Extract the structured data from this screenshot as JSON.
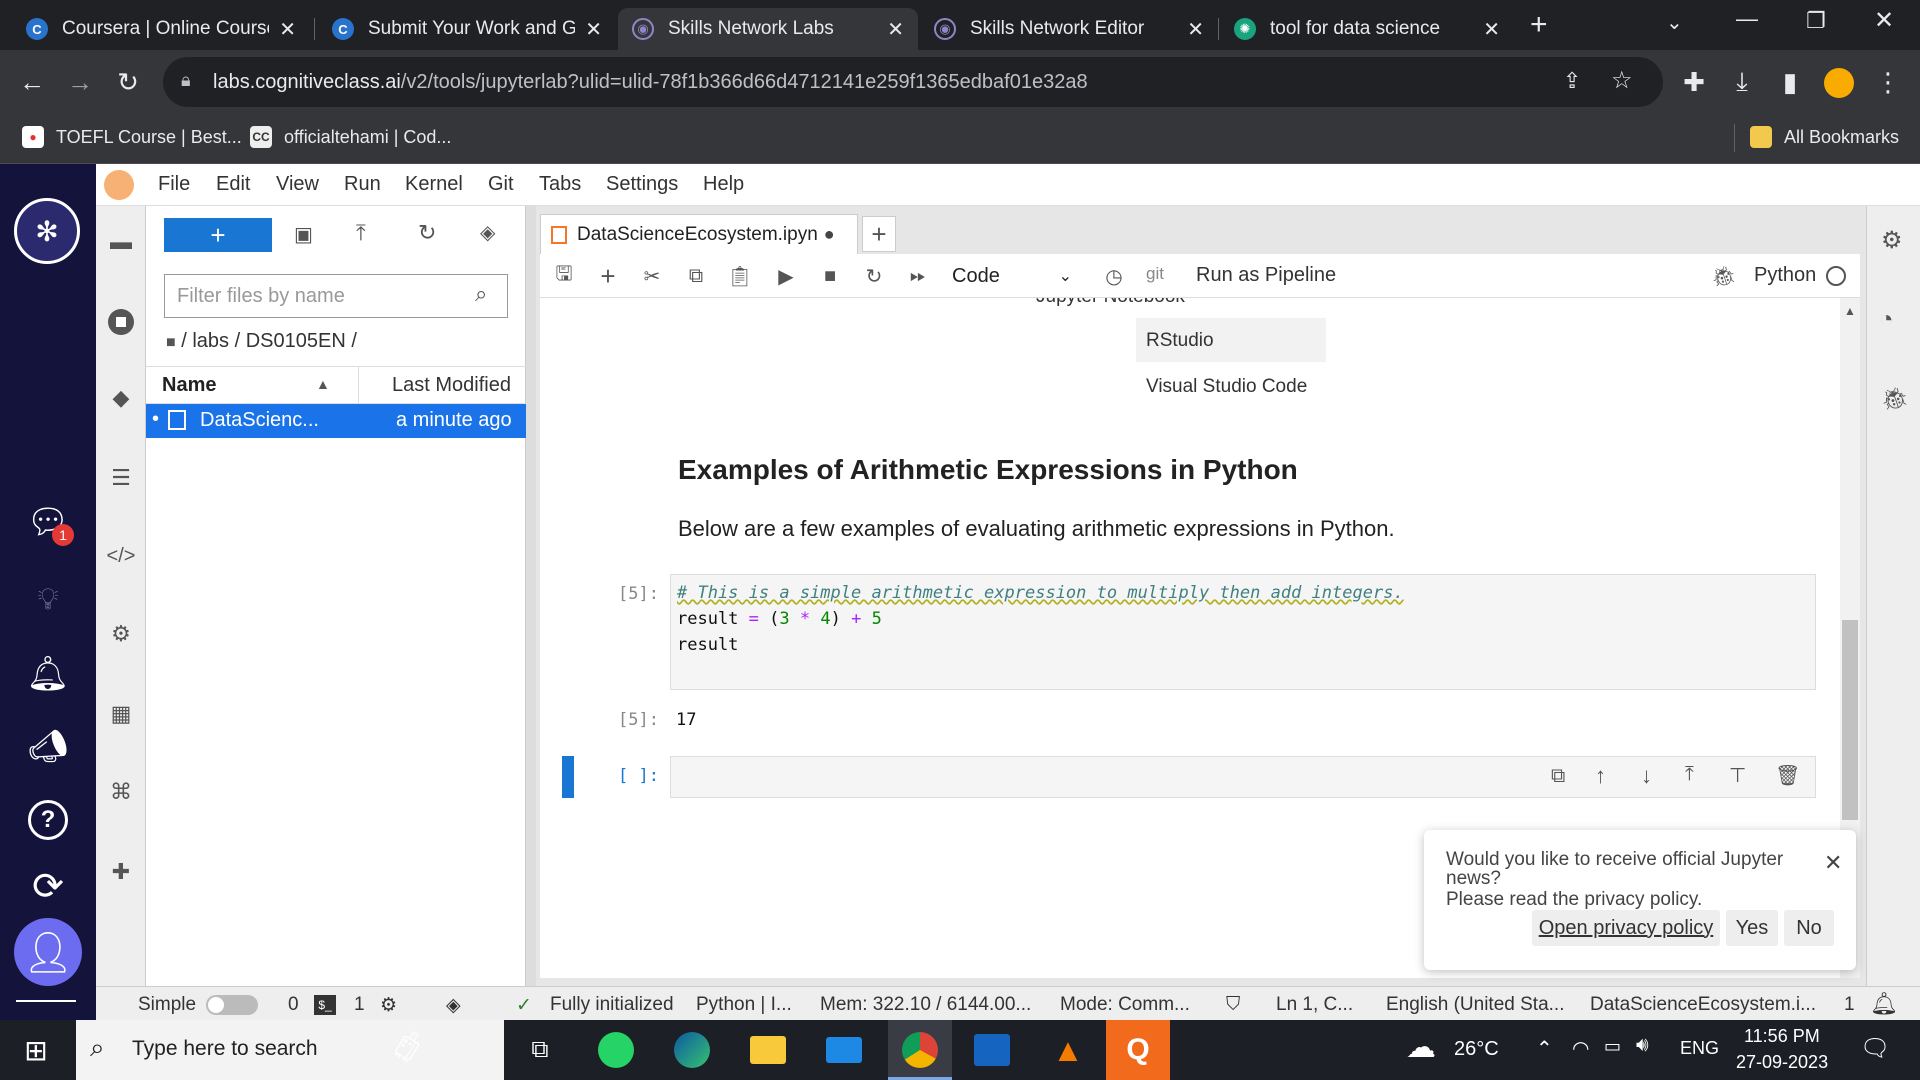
{
  "browser": {
    "tabs": [
      {
        "title": "Coursera | Online Course",
        "icon": "coursera-icon",
        "active": false
      },
      {
        "title": "Submit Your Work and Gr",
        "icon": "coursera-icon",
        "active": false
      },
      {
        "title": "Skills Network Labs",
        "icon": "skills-network-icon",
        "active": true
      },
      {
        "title": "Skills Network Editor",
        "icon": "skills-network-icon",
        "active": false
      },
      {
        "title": "tool for data science",
        "icon": "chatgpt-icon",
        "active": false
      }
    ],
    "url_host": "labs.cognitiveclass.ai",
    "url_path": "/v2/tools/jupyterlab?ulid=ulid-78f1b366d66d4712141e259f1365edbaf01e32a8",
    "bookmarks": [
      {
        "label": "TOEFL Course | Best..."
      },
      {
        "label": "officialtehami | Cod..."
      }
    ],
    "all_bookmarks": "All Bookmarks"
  },
  "leftnav": {
    "notification_count": "1"
  },
  "menubar": [
    "File",
    "Edit",
    "View",
    "Run",
    "Kernel",
    "Git",
    "Tabs",
    "Settings",
    "Help"
  ],
  "filebrowser": {
    "new_button": "+",
    "filter_placeholder": "Filter files by name",
    "breadcrumb": "/ labs / DS0105EN /",
    "col_name": "Name",
    "col_modified": "Last Modified",
    "files": [
      {
        "name": "DataScienc...",
        "modified": "a minute ago"
      }
    ]
  },
  "notebook": {
    "tab_title": "DataScienceEcosystem.ipyn",
    "cell_type": "Code",
    "git_label": "git",
    "pipeline_label": "Run as Pipeline",
    "kernel": "Python",
    "table_rows": [
      "Jupyter Notebook",
      "RStudio",
      "Visual Studio Code"
    ],
    "heading": "Examples of Arithmetic Expressions in Python",
    "paragraph": "Below are a few examples of evaluating arithmetic expressions in Python.",
    "code_prompt": "[5]:",
    "code_lines": {
      "comment": "# This is a simple arithmetic expression to multiply then add integers.",
      "line2_var": "result",
      "line2_eq": "=",
      "line2_open": "(",
      "line2_a": "3",
      "line2_mul": "*",
      "line2_b": "4",
      "line2_close": ")",
      "line2_plus": "+",
      "line2_c": "5",
      "line3": "result"
    },
    "output_prompt": "[5]:",
    "output_value": "17",
    "empty_prompt": "[ ]:"
  },
  "notification": {
    "question": "Would you like to receive official Jupyter news?",
    "privacy": "Please read the privacy policy.",
    "open_link": "Open privacy policy",
    "yes": "Yes",
    "no": "No"
  },
  "statusbar": {
    "mode_label": "Simple",
    "terminals": "0",
    "kernels": "1",
    "init": "Fully initialized",
    "kernel": "Python | I...",
    "mem": "Mem: 322.10 / 6144.00...",
    "mode": "Mode: Comm...",
    "position": "Ln 1, C...",
    "language": "English (United Sta...",
    "file": "DataScienceEcosystem.i...",
    "count": "1"
  },
  "taskbar": {
    "search_placeholder": "Type here to search",
    "temperature": "26°C",
    "lang": "ENG",
    "time": "11:56 PM",
    "date": "27-09-2023"
  }
}
